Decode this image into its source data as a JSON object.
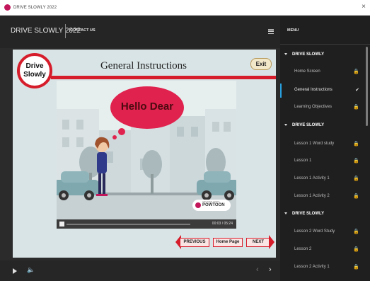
{
  "window": {
    "title": "DRIVE SLOWLY 2022",
    "close_glyph": "×"
  },
  "header": {
    "course_title": "DRIVE SLOWLY 2022",
    "contact_label": "CONTACT US",
    "menu_icon": "hamburger-icon"
  },
  "slide": {
    "badge_line1": "Drive",
    "badge_line2": "Slowly",
    "title": "General Instructions",
    "exit_label": "Exit",
    "bubble_text": "Hello Dear",
    "watermark_small": "CREATED USING",
    "watermark_brand": "POWTOON",
    "video_time": "00:03 / 05:24",
    "nav": {
      "previous": "PREVIOUS",
      "home": "Home Page",
      "next": "NEXT"
    },
    "accent_color": "#d61d2b"
  },
  "footer": {
    "volume_glyph": "🔈",
    "prev_glyph": "‹",
    "next_glyph": "›"
  },
  "sidebar": {
    "heading": "MENU",
    "items": [
      {
        "label": "DRIVE SLOWLY",
        "type": "section"
      },
      {
        "label": "Home Screen",
        "icon": "lock"
      },
      {
        "label": "General Instructions",
        "icon": "check",
        "active": true
      },
      {
        "label": "Learning Objectives",
        "icon": "lock"
      },
      {
        "label": "DRIVE SLOWLY",
        "type": "section"
      },
      {
        "label": "Lesson 1 Word study",
        "icon": "lock"
      },
      {
        "label": "Lesson 1",
        "icon": "lock"
      },
      {
        "label": "Lesson 1 Activity 1",
        "icon": "lock"
      },
      {
        "label": "Lesson 1 Activity 2",
        "icon": "lock"
      },
      {
        "label": "DRIVE SLOWLY",
        "type": "section"
      },
      {
        "label": "Lesson 2 Word Study",
        "icon": "lock"
      },
      {
        "label": "Lesson 2",
        "icon": "lock"
      },
      {
        "label": "Lesson 2 Activity 1",
        "icon": "lock"
      }
    ]
  }
}
